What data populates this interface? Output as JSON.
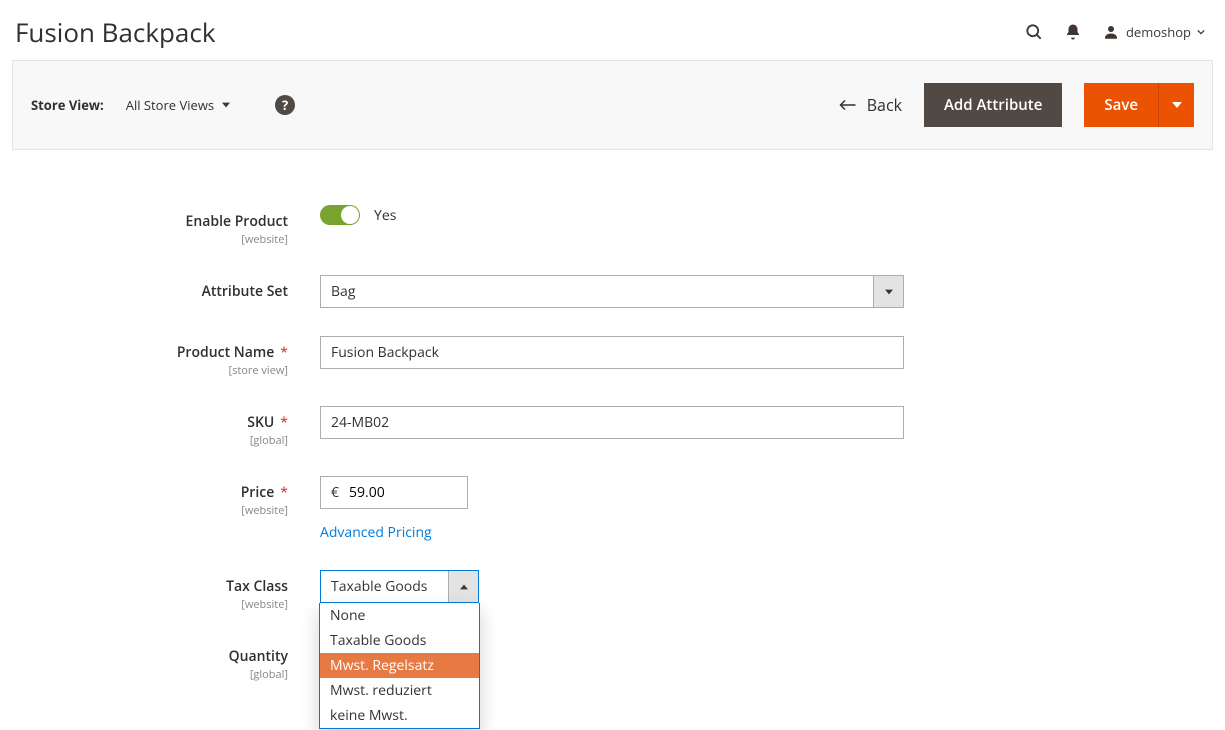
{
  "header": {
    "title": "Fusion Backpack",
    "user": "demoshop"
  },
  "toolbar": {
    "store_view_label": "Store View:",
    "store_view_value": "All Store Views",
    "back_label": "Back",
    "add_attribute_label": "Add Attribute",
    "save_label": "Save"
  },
  "form": {
    "enable_product": {
      "label": "Enable Product",
      "scope": "[website]",
      "value": "Yes"
    },
    "attribute_set": {
      "label": "Attribute Set",
      "value": "Bag"
    },
    "product_name": {
      "label": "Product Name",
      "scope": "[store view]",
      "value": "Fusion Backpack"
    },
    "sku": {
      "label": "SKU",
      "scope": "[global]",
      "value": "24-MB02"
    },
    "price": {
      "label": "Price",
      "scope": "[website]",
      "currency": "€",
      "value": "59.00",
      "advanced_link": "Advanced Pricing"
    },
    "tax_class": {
      "label": "Tax Class",
      "scope": "[website]",
      "value": "Taxable Goods",
      "options": [
        "None",
        "Taxable Goods",
        "Mwst. Regelsatz",
        "Mwst. reduziert",
        "keine Mwst."
      ],
      "highlighted_index": 2
    },
    "quantity": {
      "label": "Quantity",
      "scope": "[global]"
    }
  }
}
